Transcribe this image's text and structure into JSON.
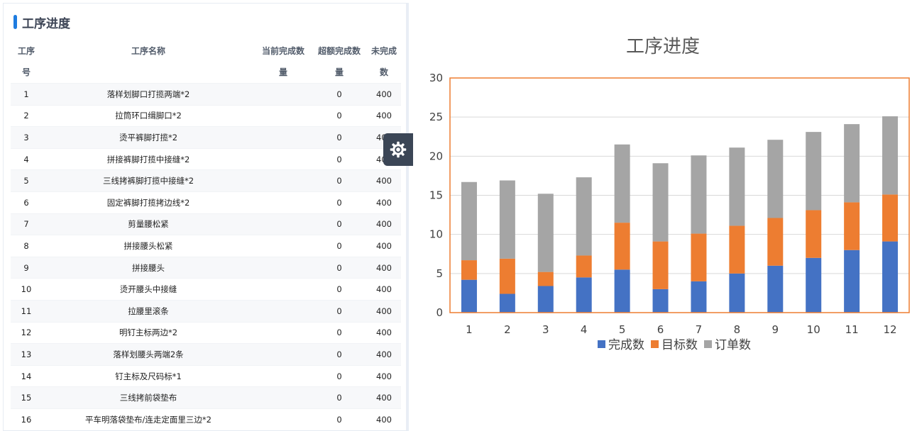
{
  "panel": {
    "title": "工序进度",
    "columns": [
      [
        "工序",
        "号"
      ],
      [
        "工序名称",
        ""
      ],
      [
        "当前完成数",
        "量"
      ],
      [
        "超额完成数",
        "量"
      ],
      [
        "未完成",
        "数"
      ]
    ],
    "rows": [
      {
        "no": "1",
        "name": "落样划脚口打揽两端*2",
        "current": "",
        "over": "0",
        "unfinished": "400"
      },
      {
        "no": "2",
        "name": "拉筒环口缉脚口*2",
        "current": "",
        "over": "0",
        "unfinished": "400"
      },
      {
        "no": "3",
        "name": "烫平裤脚打揽*2",
        "current": "",
        "over": "0",
        "unfinished": "400"
      },
      {
        "no": "4",
        "name": "拼接裤脚打揽中接缝*2",
        "current": "",
        "over": "0",
        "unfinished": "400"
      },
      {
        "no": "5",
        "name": "三线拷裤脚打揽中接缝*2",
        "current": "",
        "over": "0",
        "unfinished": "400"
      },
      {
        "no": "6",
        "name": "固定裤脚打揽拷边线*2",
        "current": "",
        "over": "0",
        "unfinished": "400"
      },
      {
        "no": "7",
        "name": "剪量腰松紧",
        "current": "",
        "over": "0",
        "unfinished": "400"
      },
      {
        "no": "8",
        "name": "拼接腰头松紧",
        "current": "",
        "over": "0",
        "unfinished": "400"
      },
      {
        "no": "9",
        "name": "拼接腰头",
        "current": "",
        "over": "0",
        "unfinished": "400"
      },
      {
        "no": "10",
        "name": "烫开腰头中接缝",
        "current": "",
        "over": "0",
        "unfinished": "400"
      },
      {
        "no": "11",
        "name": "拉腰里滚条",
        "current": "",
        "over": "0",
        "unfinished": "400"
      },
      {
        "no": "12",
        "name": "明钉主标两边*2",
        "current": "",
        "over": "0",
        "unfinished": "400"
      },
      {
        "no": "13",
        "name": "落样划腰头两端2条",
        "current": "",
        "over": "0",
        "unfinished": "400"
      },
      {
        "no": "14",
        "name": "钉主标及尺码标*1",
        "current": "",
        "over": "0",
        "unfinished": "400"
      },
      {
        "no": "15",
        "name": "三线拷前袋垫布",
        "current": "",
        "over": "0",
        "unfinished": "400"
      },
      {
        "no": "16",
        "name": "平车明落袋垫布/连走定面里三边*2",
        "current": "",
        "over": "0",
        "unfinished": "400"
      }
    ]
  },
  "settings_icon": "gear-icon",
  "colors": {
    "accent": "#1e7ce0",
    "series_done": "#4472c4",
    "series_target": "#ed7d31",
    "series_order": "#a5a5a5",
    "plot_border": "#ed7d31"
  },
  "chart_data": {
    "type": "bar",
    "stacked": true,
    "title": "工序进度",
    "categories": [
      "1",
      "2",
      "3",
      "4",
      "5",
      "6",
      "7",
      "8",
      "9",
      "10",
      "11",
      "12"
    ],
    "series": [
      {
        "name": "完成数",
        "values": [
          4.2,
          2.4,
          3.4,
          4.5,
          5.5,
          3.0,
          4.0,
          5.0,
          6.0,
          7.0,
          8.0,
          9.1
        ]
      },
      {
        "name": "目标数",
        "values": [
          2.5,
          4.5,
          1.8,
          2.8,
          6.0,
          6.1,
          6.1,
          6.1,
          6.1,
          6.1,
          6.1,
          6.0
        ]
      },
      {
        "name": "订单数",
        "values": [
          10.0,
          10.0,
          10.0,
          10.0,
          10.0,
          10.0,
          10.0,
          10.0,
          10.0,
          10.0,
          10.0,
          10.0
        ]
      }
    ],
    "ylim": [
      0,
      30
    ],
    "yticks": [
      "0",
      "5",
      "10",
      "15",
      "20",
      "25",
      "30"
    ],
    "grid": true,
    "legend": "bottom"
  }
}
